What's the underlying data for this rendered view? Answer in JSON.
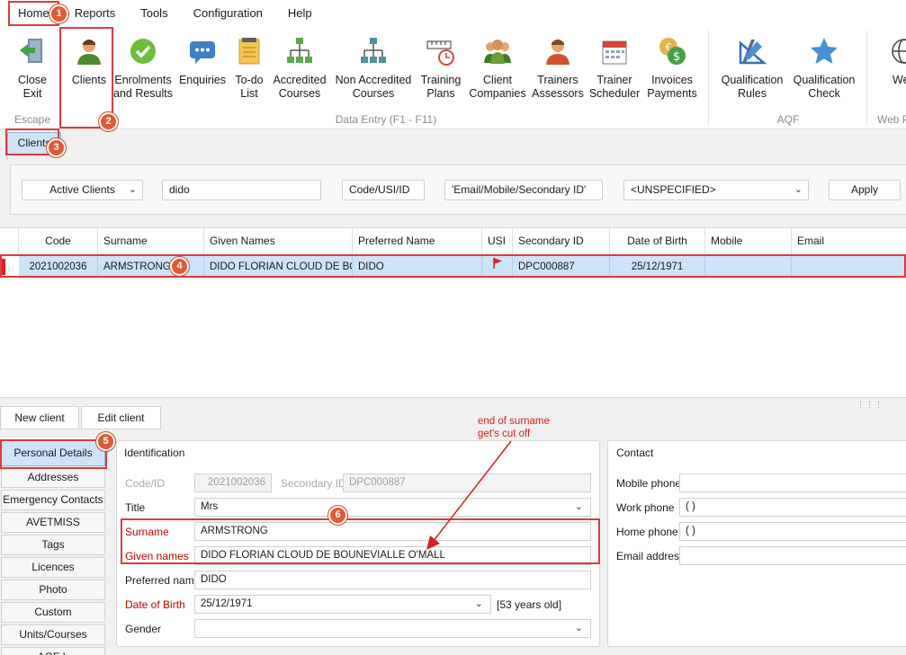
{
  "menu": [
    "Home",
    "Reports",
    "Tools",
    "Configuration",
    "Help"
  ],
  "ribbon": {
    "close_exit": [
      "Close",
      "Exit"
    ],
    "escape_label": "Escape",
    "clients": "Clients",
    "enrolments": [
      "Enrolments",
      "and Results"
    ],
    "enquiries": "Enquiries",
    "todo": [
      "To-do",
      "List"
    ],
    "accredited": [
      "Accredited",
      "Courses"
    ],
    "non_accredited": [
      "Non Accredited",
      "Courses"
    ],
    "training_plans": [
      "Training",
      "Plans"
    ],
    "client_companies": [
      "Client",
      "Companies"
    ],
    "trainers_assessors": [
      "Trainers",
      "Assessors"
    ],
    "trainer_scheduler": [
      "Trainer",
      "Scheduler"
    ],
    "invoices_payments": [
      "Invoices",
      "Payments"
    ],
    "data_entry_label": "Data Entry (F1 - F11)",
    "qualification_rules": [
      "Qualification",
      "Rules"
    ],
    "qualification_check": [
      "Qualification",
      "Check"
    ],
    "aqf_label": "AQF",
    "web_partial": "We",
    "web_group_partial": "Web P"
  },
  "tab": "Clients",
  "filter": {
    "status": "Active Clients",
    "search_value": "dido",
    "code_usi": "Code/USI/ID",
    "email_mobile": "'Email/Mobile/Secondary ID'",
    "specified": "<UNSPECIFIED>",
    "apply": "Apply"
  },
  "grid": {
    "columns": [
      "Code",
      "Surname",
      "Given Names",
      "Preferred Name",
      "USI",
      "Secondary ID",
      "Date of Birth",
      "Mobile",
      "Email"
    ],
    "row": {
      "code": "2021002036",
      "surname": "ARMSTRONG",
      "given": "DIDO FLORIAN CLOUD DE BOUNEVIALLE O'MALL",
      "preferred": "DIDO",
      "usi": "",
      "secondary": "DPC000887",
      "dob": "25/12/1971",
      "mobile": "",
      "email": ""
    }
  },
  "buttons": {
    "new_client": "New client",
    "edit_client": "Edit client"
  },
  "sidenav": [
    "Personal Details",
    "Addresses",
    "Emergency Contacts",
    "AVETMISS",
    "Tags",
    "Licences",
    "Photo",
    "Custom",
    "Units/Courses",
    "AQF L"
  ],
  "identification": {
    "title": "Identification",
    "code_label": "Code/ID",
    "code_value": "2021002036",
    "secondary_label": "Secondary ID",
    "secondary_value": "DPC000887",
    "title_label": "Title",
    "title_value": "Mrs",
    "surname_label": "Surname",
    "surname_value": "ARMSTRONG",
    "given_label": "Given names",
    "given_value": "DIDO FLORIAN CLOUD DE BOUNEVIALLE O'MALL",
    "preferred_label": "Preferred name",
    "preferred_value": "DIDO",
    "dob_label": "Date of Birth",
    "dob_value": "25/12/1971",
    "age": "[53 years old]",
    "gender_label": "Gender",
    "gender_value": ""
  },
  "contact": {
    "title": "Contact",
    "mobile_label": "Mobile phone",
    "work_label": "Work phone",
    "work_value": "(   )",
    "home_label": "Home phone",
    "home_value": "(   )",
    "email_label": "Email address"
  },
  "annotations": {
    "badges": [
      "1",
      "2",
      "3",
      "4",
      "5",
      "6"
    ],
    "note_line1": "end of surname",
    "note_line2": "get's cut off"
  },
  "colors": {
    "highlight": "#e03a3a",
    "badge": "#e25a35",
    "selection": "#cde3f8",
    "required": "#c00000"
  }
}
